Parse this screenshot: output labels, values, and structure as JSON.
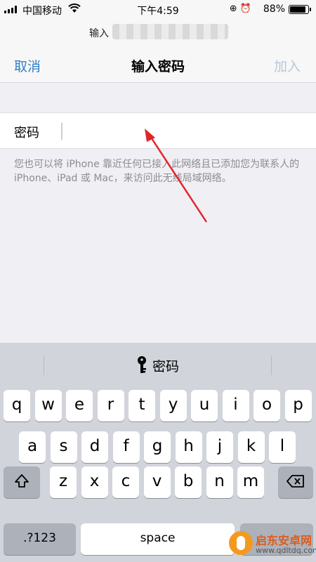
{
  "status_bar": {
    "carrier": "中国移动",
    "wifi_icon": "wifi-icon",
    "time": "下午4:59",
    "icons": "⊕ ⏰",
    "battery_percent": "88%",
    "battery_level": 0.88
  },
  "sheet": {
    "prompt": "输入",
    "cancel": "取消",
    "title": "输入密码",
    "add": "加入"
  },
  "password": {
    "label": "密码",
    "value": "",
    "placeholder": ""
  },
  "hint": "您也可以将 iPhone 靠近任何已接入此网络且已添加您为联系人的 iPhone、iPad 或 Mac，来访问此无线局域网络。",
  "keyboard": {
    "suggestion": "密码",
    "suggestion_icon": "key-icon",
    "row1": [
      "q",
      "w",
      "e",
      "r",
      "t",
      "y",
      "u",
      "i",
      "o",
      "p"
    ],
    "row2": [
      "a",
      "s",
      "d",
      "f",
      "g",
      "h",
      "j",
      "k",
      "l"
    ],
    "row3": [
      "z",
      "x",
      "c",
      "v",
      "b",
      "n",
      "m"
    ],
    "shift_icon": "shift-icon",
    "delete_icon": "delete-icon",
    "numbers": ".?123",
    "space": "space"
  },
  "watermark": {
    "name": "启东安卓网",
    "url": "www.qdltdq.com"
  }
}
